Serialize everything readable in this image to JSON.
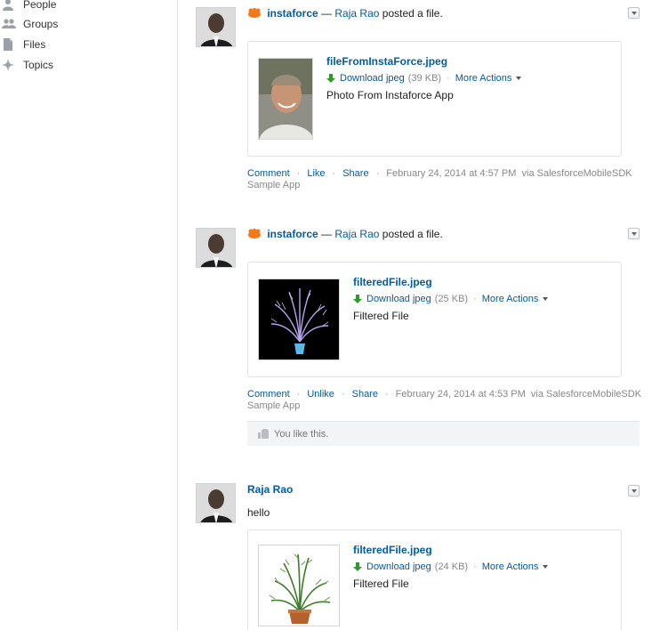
{
  "sidebar": {
    "items": [
      {
        "label": "People",
        "icon": "person-icon"
      },
      {
        "label": "Groups",
        "icon": "groups-icon"
      },
      {
        "label": "Files",
        "icon": "file-icon"
      },
      {
        "label": "Topics",
        "icon": "topics-icon"
      }
    ]
  },
  "feed": {
    "posts": [
      {
        "app": "instaforce",
        "dash": "—",
        "author": "Raja Rao",
        "verb": "posted a file.",
        "file_name": "fileFromInstaForce.jpeg",
        "download_label": "Download jpeg",
        "size": "(39 KB)",
        "more_actions": "More Actions",
        "description": "Photo From Instaforce App",
        "comment": "Comment",
        "like": "Like",
        "share": "Share",
        "timestamp": "February 24, 2014 at 4:57 PM",
        "via": "via SalesforceMobileSDK Sample App"
      },
      {
        "app": "instaforce",
        "dash": "—",
        "author": "Raja Rao",
        "verb": "posted a file.",
        "file_name": "filteredFile.jpeg",
        "download_label": "Download jpeg",
        "size": "(25 KB)",
        "more_actions": "More Actions",
        "description": "Filtered File",
        "comment": "Comment",
        "like": "Unlike",
        "share": "Share",
        "timestamp": "February 24, 2014 at 4:53 PM",
        "via": "via SalesforceMobileSDK Sample App",
        "you_like": "You like this."
      },
      {
        "author": "Raja Rao",
        "body": "hello",
        "file_name": "filteredFile.jpeg",
        "download_label": "Download jpeg",
        "size": "(24 KB)",
        "more_actions": "More Actions",
        "description": "Filtered File"
      }
    ]
  },
  "colors": {
    "link": "#015ba7",
    "download_arrow": "#2f9a2a",
    "app_logo": "#f07a1a"
  }
}
